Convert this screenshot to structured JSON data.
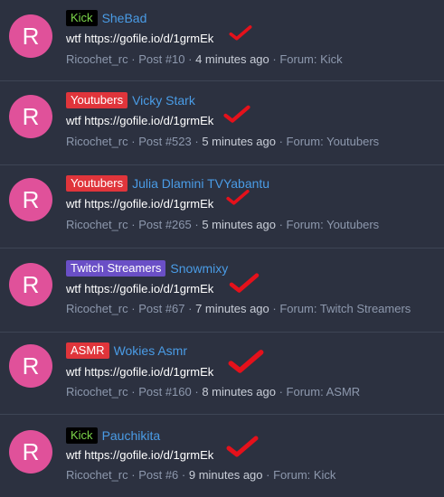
{
  "colors": {
    "background": "#2c3140",
    "avatar": "#e0519a",
    "link": "#4a9ce6",
    "meta": "#8d98ad",
    "checkmark": "#e5111b"
  },
  "posts": [
    {
      "avatar_letter": "R",
      "tag": "Kick",
      "tag_style": "kick",
      "title": "SheBad",
      "body": "wtf https://gofile.io/d/1grmEk",
      "author": "Ricochet_rc",
      "post_number": "Post #10",
      "time": "4 minutes ago",
      "forum": "Forum: Kick"
    },
    {
      "avatar_letter": "R",
      "tag": "Youtubers",
      "tag_style": "youtubers",
      "title": "Vicky Stark",
      "body": "wtf https://gofile.io/d/1grmEk",
      "author": "Ricochet_rc",
      "post_number": "Post #523",
      "time": "5 minutes ago",
      "forum": "Forum: Youtubers"
    },
    {
      "avatar_letter": "R",
      "tag": "Youtubers",
      "tag_style": "youtubers",
      "title": "Julia Dlamini TVYabantu",
      "body": "wtf https://gofile.io/d/1grmEk",
      "author": "Ricochet_rc",
      "post_number": "Post #265",
      "time": "5 minutes ago",
      "forum": "Forum: Youtubers"
    },
    {
      "avatar_letter": "R",
      "tag": "Twitch Streamers",
      "tag_style": "twitch",
      "title": "Snowmixy",
      "body": "wtf https://gofile.io/d/1grmEk",
      "author": "Ricochet_rc",
      "post_number": "Post #67",
      "time": "7 minutes ago",
      "forum": "Forum: Twitch Streamers"
    },
    {
      "avatar_letter": "R",
      "tag": "ASMR",
      "tag_style": "asmr",
      "title": "Wokies Asmr",
      "body": "wtf https://gofile.io/d/1grmEk",
      "author": "Ricochet_rc",
      "post_number": "Post #160",
      "time": "8 minutes ago",
      "forum": "Forum: ASMR"
    },
    {
      "avatar_letter": "R",
      "tag": "Kick",
      "tag_style": "kick",
      "title": "Pauchikita",
      "body": "wtf https://gofile.io/d/1grmEk",
      "author": "Ricochet_rc",
      "post_number": "Post #6",
      "time": "9 minutes ago",
      "forum": "Forum: Kick"
    }
  ]
}
